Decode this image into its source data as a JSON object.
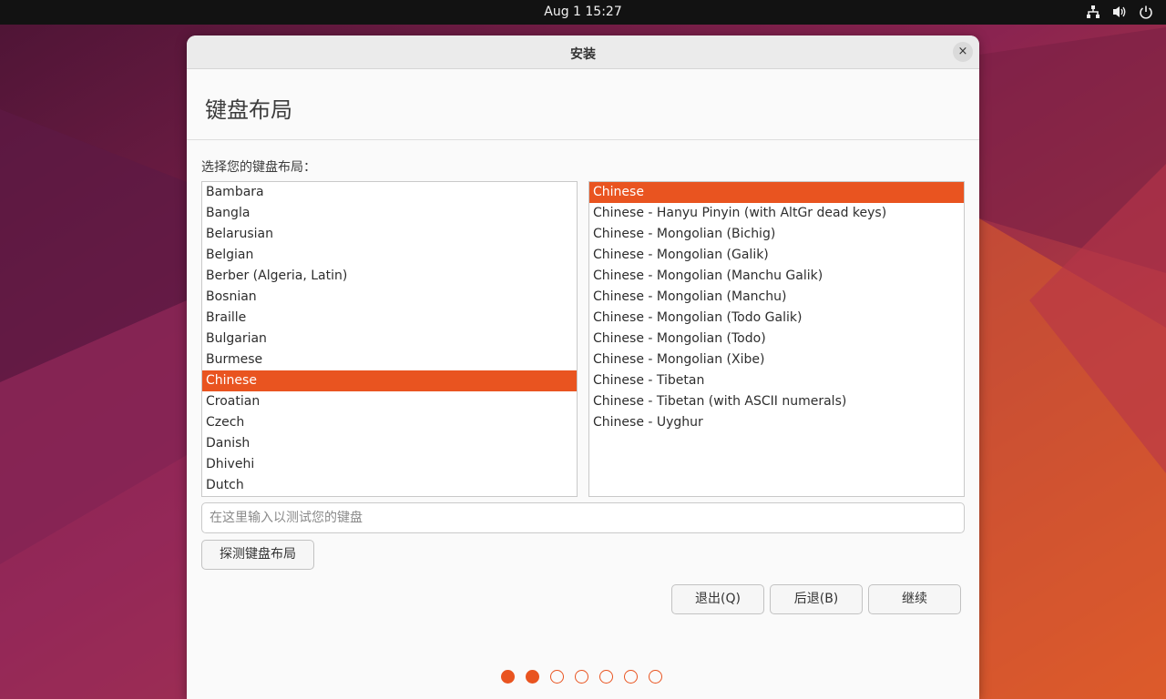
{
  "topbar": {
    "clock": "Aug 1  15:27",
    "icons": [
      "network-icon",
      "volume-icon",
      "power-icon"
    ]
  },
  "window": {
    "title": "安装",
    "close_label": "×",
    "heading": "键盘布局",
    "prompt": "选择您的键盘布局：",
    "layouts": [
      "Bambara",
      "Bangla",
      "Belarusian",
      "Belgian",
      "Berber (Algeria, Latin)",
      "Bosnian",
      "Braille",
      "Bulgarian",
      "Burmese",
      "Chinese",
      "Croatian",
      "Czech",
      "Danish",
      "Dhivehi",
      "Dutch"
    ],
    "selected_layout": "Chinese",
    "variants": [
      "Chinese",
      "Chinese - Hanyu Pinyin (with AltGr dead keys)",
      "Chinese - Mongolian (Bichig)",
      "Chinese - Mongolian (Galik)",
      "Chinese - Mongolian (Manchu Galik)",
      "Chinese - Mongolian (Manchu)",
      "Chinese - Mongolian (Todo Galik)",
      "Chinese - Mongolian (Todo)",
      "Chinese - Mongolian (Xibe)",
      "Chinese - Tibetan",
      "Chinese - Tibetan (with ASCII numerals)",
      "Chinese - Uyghur"
    ],
    "selected_variant": "Chinese",
    "test_placeholder": "在这里输入以测试您的键盘",
    "detect_label": "探测键盘布局",
    "quit_label": "退出(Q)",
    "back_label": "后退(B)",
    "continue_label": "继续",
    "progress": {
      "total_steps": 7,
      "completed_steps": 2
    }
  },
  "colors": {
    "accent": "#e95420",
    "topbar": "#121212"
  }
}
